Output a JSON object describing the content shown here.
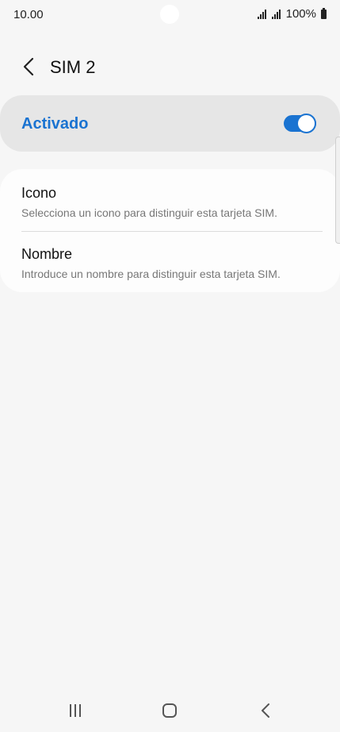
{
  "status": {
    "time": "10.00",
    "battery": "100%"
  },
  "header": {
    "title": "SIM 2"
  },
  "toggle": {
    "label": "Activado",
    "on": true,
    "accent": "#1a73d1"
  },
  "items": [
    {
      "title": "Icono",
      "subtitle": "Selecciona un icono para distinguir esta tarjeta SIM."
    },
    {
      "title": "Nombre",
      "subtitle": "Introduce un nombre para distinguir esta tarjeta SIM."
    }
  ],
  "nav": {
    "icons": [
      "recent-apps-icon",
      "home-icon",
      "back-icon"
    ]
  }
}
